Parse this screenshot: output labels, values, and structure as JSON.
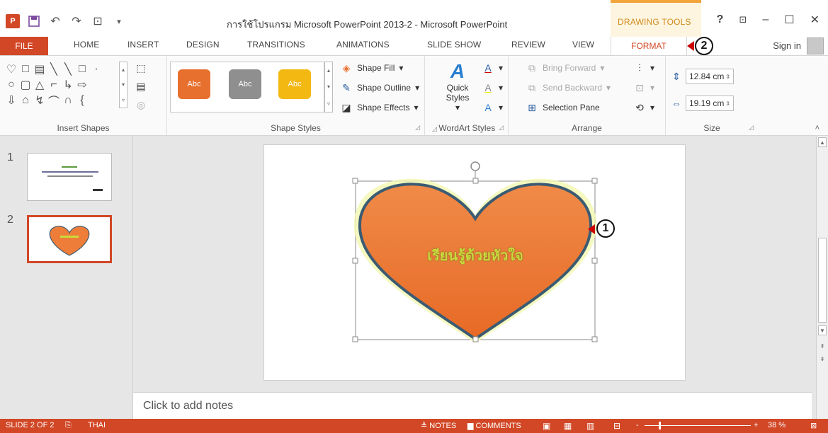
{
  "titlebar": {
    "app_logo": "P",
    "title": "การใช้โปรแกรม Microsoft PowerPoint 2013-2 - Microsoft PowerPoint",
    "contextual_tab_group": "DRAWING TOOLS",
    "help": "?",
    "restore_ribbon": "⊡",
    "minimize": "–",
    "maximize": "☐",
    "close": "✕"
  },
  "tabs": {
    "file": "FILE",
    "home": "HOME",
    "insert": "INSERT",
    "design": "DESIGN",
    "transitions": "TRANSITIONS",
    "animations": "ANIMATIONS",
    "slideshow": "SLIDE SHOW",
    "review": "REVIEW",
    "view": "VIEW",
    "format": "FORMAT",
    "signin": "Sign in"
  },
  "callouts": {
    "one": "1",
    "two": "2"
  },
  "ribbon": {
    "insert_shapes_label": "Insert Shapes",
    "shape_styles_label": "Shape Styles",
    "wordart_styles_label": "WordArt Styles",
    "arrange_label": "Arrange",
    "size_label": "Size",
    "swatch_text": "Abc",
    "shape_fill": "Shape Fill",
    "shape_outline": "Shape Outline",
    "shape_effects": "Shape Effects",
    "quick_styles_1": "Quick",
    "quick_styles_2": "Styles",
    "bring_forward": "Bring Forward",
    "send_backward": "Send Backward",
    "selection_pane": "Selection Pane",
    "height": "12.84 cm",
    "width": "19.19 cm"
  },
  "thumbnails": [
    {
      "number": "1"
    },
    {
      "number": "2",
      "text": "เรียนรู้ด้วยหัวใจ"
    }
  ],
  "slide": {
    "heart_text": "เรียนรู้ด้วยหัวใจ"
  },
  "notes": {
    "placeholder": "Click to add notes"
  },
  "statusbar": {
    "slide_info": "SLIDE 2 OF 2",
    "language": "THAI",
    "notes": "NOTES",
    "comments": "COMMENTS",
    "zoom_minus": "-",
    "zoom_plus": "+",
    "zoom_level": "38 %"
  },
  "colors": {
    "accent": "#d24726",
    "heart_fill": "#ee7d3a",
    "heart_outline": "#3b5b72",
    "heart_text": "#c9d93a",
    "drawing_tools": "#f2a33a"
  },
  "zoom_fraction": 0.38
}
